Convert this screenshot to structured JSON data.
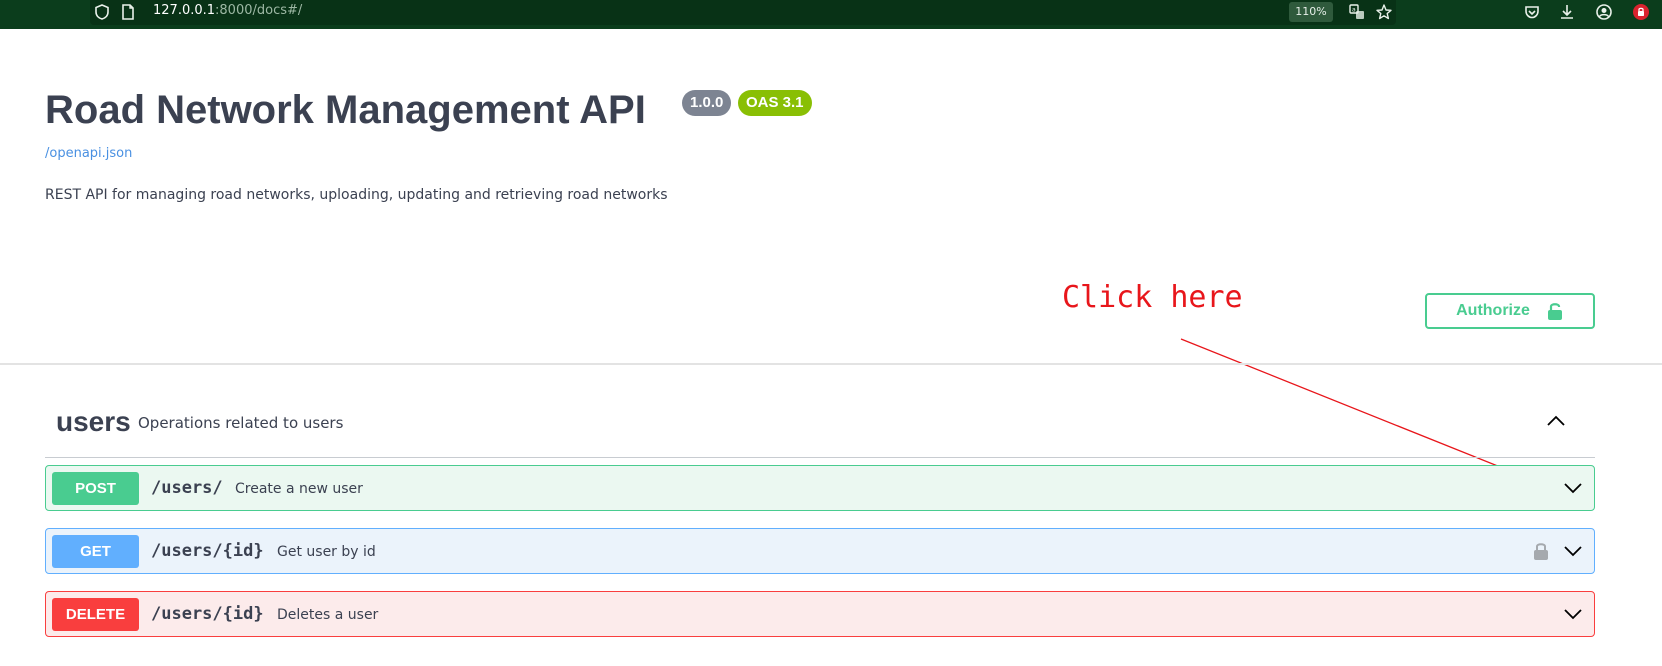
{
  "browser": {
    "url_host": "127.0.0.1",
    "url_rest": ":8000/docs#/",
    "zoom": "110%"
  },
  "info": {
    "title": "Road Network Management API",
    "version": "1.0.0",
    "oas_version": "OAS 3.1",
    "spec_link": "/openapi.json",
    "description": "REST API for managing road networks, uploading, updating and retrieving road networks"
  },
  "annotation": {
    "text": "Click here",
    "color": "#e8161b"
  },
  "authorize": {
    "label": "Authorize"
  },
  "tag": {
    "name": "users",
    "description": "Operations related to users"
  },
  "operations": [
    {
      "method": "POST",
      "path": "/users/",
      "summary": "Create a new user",
      "color": "#49cc90"
    },
    {
      "method": "GET",
      "path": "/users/{id}",
      "summary": "Get user by id",
      "color": "#61affe",
      "locked": true
    },
    {
      "method": "DELETE",
      "path": "/users/{id}",
      "summary": "Deletes a user",
      "color": "#f93e3e"
    }
  ],
  "icons": {
    "browser_bar": [
      "shield-icon",
      "page-icon",
      "translate-icon",
      "star-icon",
      "pocket-icon",
      "download-icon",
      "account-icon",
      "extension-lock-icon"
    ],
    "authorize": "unlocked-icon",
    "tag": "chevron-up-icon",
    "operation": "chevron-down-icon"
  }
}
